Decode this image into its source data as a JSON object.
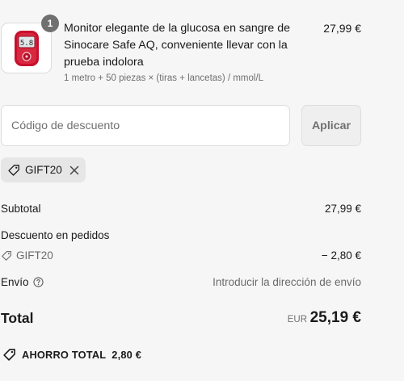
{
  "product": {
    "quantity": "1",
    "title": "Monitor elegante de la glucosa en sangre de Sinocare Safe AQ, conveniente llevar con la prueba indolora",
    "variant": "1 metro + 50 piezas × (tiras + lancetas) / mmol/L",
    "price": "27,99 €",
    "image_icon": "glucose-meter-icon",
    "meter_display": "5.8"
  },
  "discount": {
    "placeholder": "Código de descuento",
    "value": "",
    "apply_label": "Aplicar",
    "applied_code": "GIFT20"
  },
  "summary": {
    "subtotal_label": "Subtotal",
    "subtotal_value": "27,99 €",
    "discount_label": "Descuento en pedidos",
    "discount_code": "GIFT20",
    "discount_value": "− 2,80 €",
    "shipping_label": "Envío",
    "shipping_value": "Introducir la dirección de envío",
    "total_label": "Total",
    "currency": "EUR",
    "total_value": "25,19 €",
    "savings_label": "AHORRO TOTAL",
    "savings_value": "2,80 €"
  },
  "colors": {
    "background": "#f6f6f6",
    "meter_red": "#c8102e",
    "badge": "#707070",
    "chip": "#e6e6e6"
  }
}
